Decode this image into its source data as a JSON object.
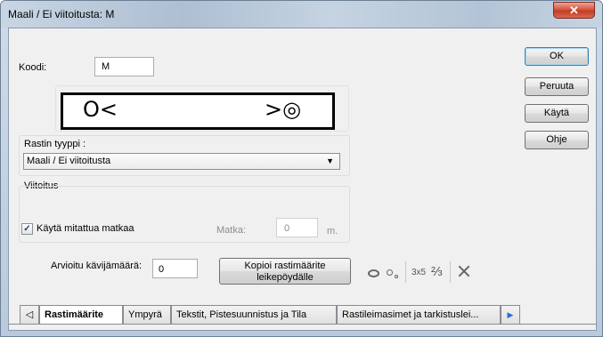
{
  "window": {
    "title": "Maali / Ei viitoitusta: M",
    "close_glyph": "✕"
  },
  "buttons": {
    "ok": "OK",
    "cancel": "Peruuta",
    "apply": "Käytä",
    "help": "Ohje"
  },
  "code": {
    "label": "Koodi:",
    "value": "M"
  },
  "symbol_preview": {
    "left": "O<",
    "right": ">◎"
  },
  "control_type": {
    "label": "Rastin tyyppi :",
    "value": "Maali / Ei viitoitusta"
  },
  "marking": {
    "group_label": "Viitoitus",
    "checkbox_label": "Käytä mitattua matkaa",
    "checked": true,
    "distance_label": "Matka:",
    "distance_value": "0",
    "unit": "m."
  },
  "visitors": {
    "label": "Arvioitu kävijämäärä:",
    "value": "0"
  },
  "copy_button": {
    "line1": "Kopioi rastimäärite",
    "line2": "leikepöydälle"
  },
  "tool_icons": [
    "ellipse-icon",
    "small-circles-icon",
    "grid-3x5-icon",
    "fraction-icon",
    "cross-icon"
  ],
  "tool_text": {
    "grid": "3x5",
    "fraction": "⅔"
  },
  "tabs": [
    {
      "label": "Rastimäärite",
      "active": true
    },
    {
      "label": "Ympyrä",
      "active": false
    },
    {
      "label": "Tekstit, Pistesuunnistus ja Tila",
      "active": false
    },
    {
      "label": "Rastileimasimet ja tarkistuslei...",
      "active": false
    }
  ],
  "tab_scroll": {
    "left": "◁",
    "right": "▶"
  }
}
